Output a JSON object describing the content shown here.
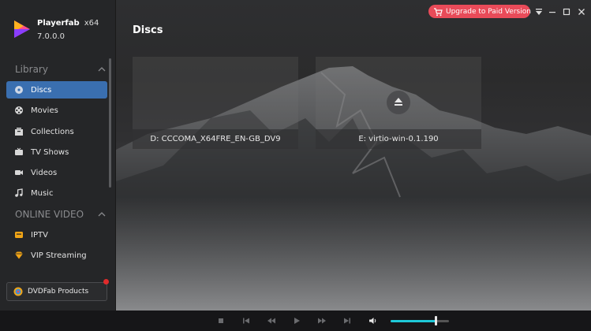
{
  "app": {
    "brand": "Playerfab",
    "arch": "x64",
    "version": "7.0.0.0"
  },
  "sidebar": {
    "library_heading": "Library",
    "library_items": [
      {
        "label": "Discs",
        "icon": "disc-icon",
        "active": true
      },
      {
        "label": "Movies",
        "icon": "film-reel-icon"
      },
      {
        "label": "Collections",
        "icon": "collections-icon"
      },
      {
        "label": "TV Shows",
        "icon": "tv-icon"
      },
      {
        "label": "Videos",
        "icon": "video-camera-icon"
      },
      {
        "label": "Music",
        "icon": "music-note-icon"
      }
    ],
    "online_heading": "ONLINE VIDEO",
    "online_items": [
      {
        "label": "IPTV",
        "icon": "iptv-icon"
      },
      {
        "label": "VIP Streaming",
        "icon": "diamond-icon"
      }
    ],
    "products_label": "DVDFab Products"
  },
  "main": {
    "title": "Discs",
    "discs": [
      {
        "label": "D: CCCOMA_X64FRE_EN-GB_DV9",
        "ejectable": false
      },
      {
        "label": "E: virtio-win-0.1.190",
        "ejectable": true
      }
    ]
  },
  "topbar": {
    "upgrade_label": "Upgrade to Paid Version"
  },
  "player": {
    "volume": 0.78
  },
  "colors": {
    "accent": "#3a6fb0",
    "upgrade": "#e94b59",
    "volume_fill": "#1ec8d8",
    "notification_dot": "#e02b2b"
  }
}
